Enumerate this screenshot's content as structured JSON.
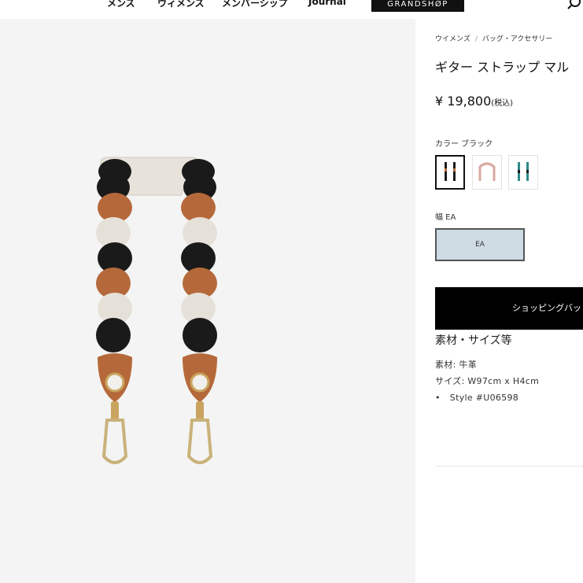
{
  "nav": {
    "items": [
      "メンズ",
      "ウィメンズ",
      "メンバーシップ",
      "Journal"
    ],
    "brand": "GRANDSHØP",
    "search_icon": "search-icon"
  },
  "breadcrumb": {
    "items": [
      "ウイメンズ",
      "バッグ・アクセサリー"
    ],
    "separator": "/"
  },
  "product": {
    "title": "ギター ストラップ マル",
    "price": "¥ 19,800",
    "tax": "(税込)",
    "color_label": "カラー ブラック",
    "color_swatches": [
      {
        "name": "black",
        "selected": true
      },
      {
        "name": "pink",
        "selected": false
      },
      {
        "name": "teal",
        "selected": false
      }
    ],
    "width_label": "幅 EA",
    "size_option": "EA",
    "cart_button": "ショッピングバッ",
    "spec_heading": "素材・サイズ等",
    "material": "素材: 牛革",
    "size": "サイズ: W97cm x H4cm",
    "style_bullet": "•",
    "style": "Style #U06598"
  },
  "colors": {
    "black": "#1a1a1a",
    "tan": "#b5693a",
    "cream": "#e6e1d8",
    "size_bg": "#cfdbe3",
    "panel_bg": "#f4f4f4"
  }
}
